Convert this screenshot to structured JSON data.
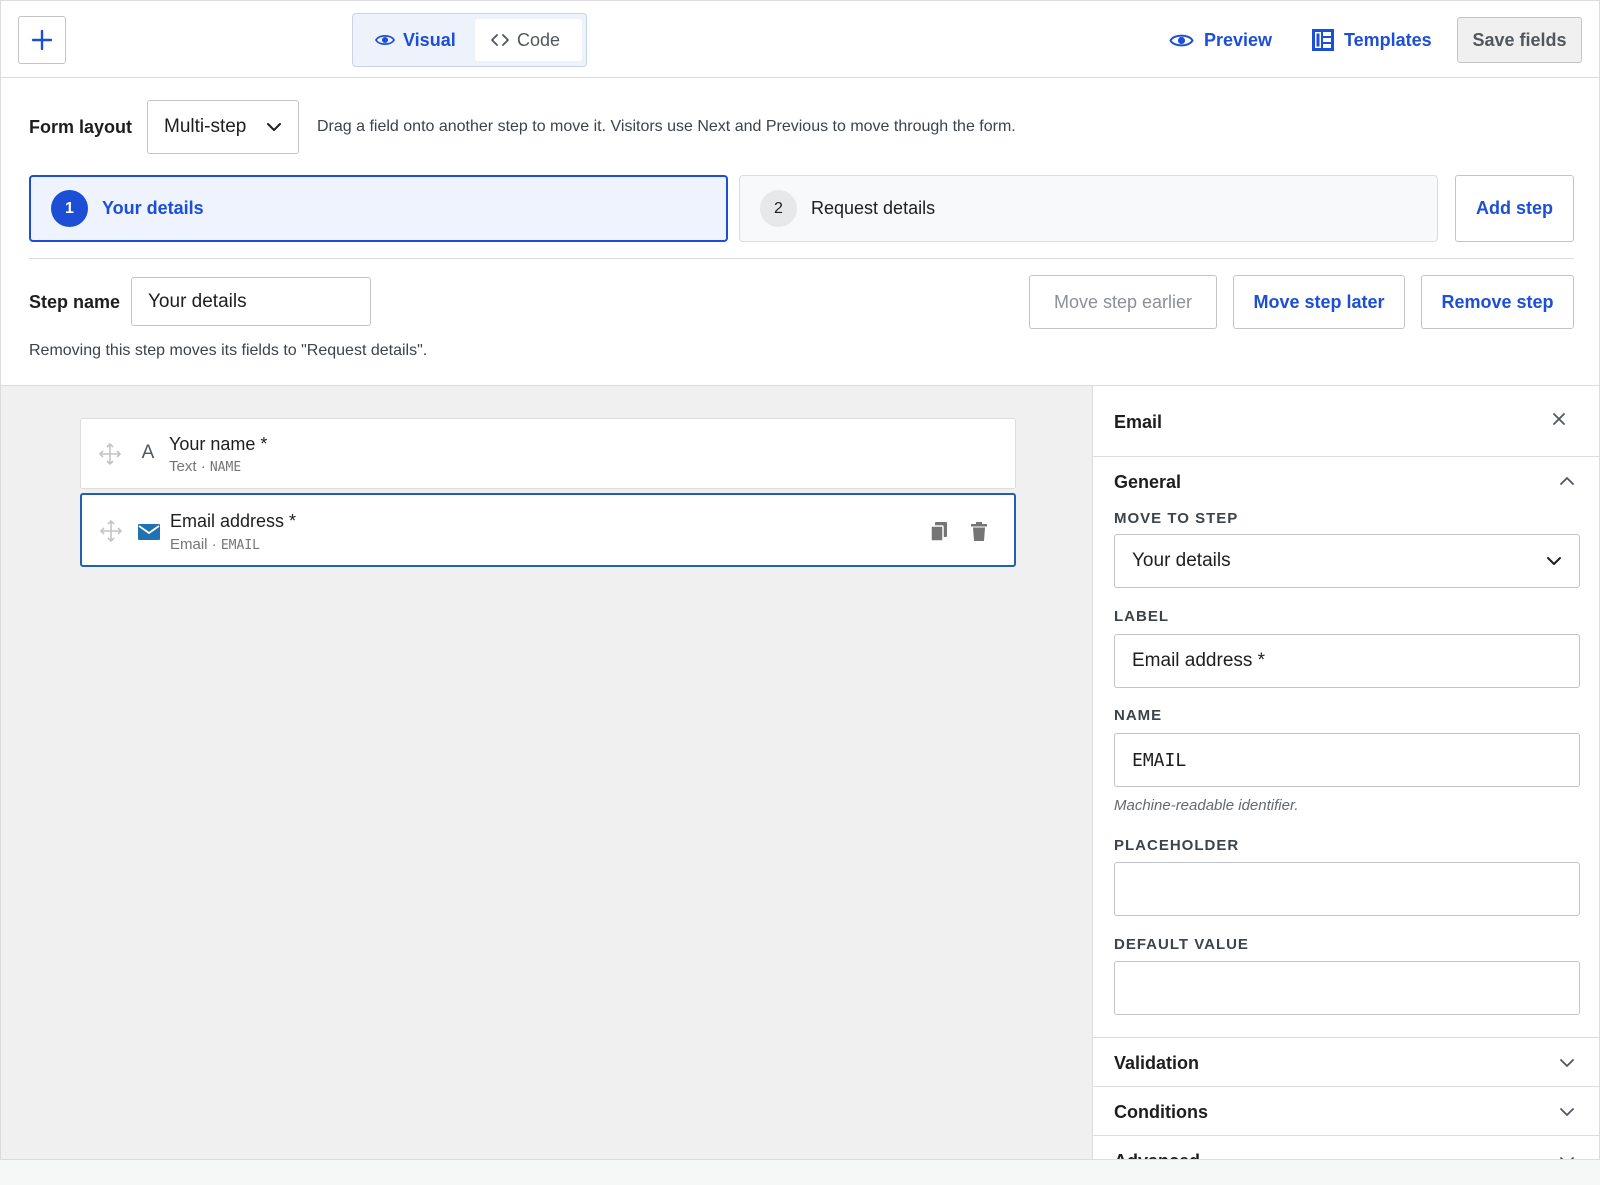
{
  "toolbar": {
    "add_icon": "plus-icon",
    "mode_visual": "Visual",
    "mode_code": "Code",
    "preview": "Preview",
    "templates": "Templates",
    "save": "Save fields",
    "accent": "#1d4fd6"
  },
  "layout": {
    "label": "Form layout",
    "selected": "Multi-step",
    "help": "Drag a field onto another step to move it. Visitors use Next and Previous to move through the form."
  },
  "steps": [
    {
      "number": "1",
      "name": "Your details",
      "active": true
    },
    {
      "number": "2",
      "name": "Request details",
      "active": false
    }
  ],
  "add_step": "Add step",
  "step_editor": {
    "label": "Step name",
    "value": "Your details",
    "move_earlier": "Move step earlier",
    "move_later": "Move step later",
    "remove": "Remove step",
    "note": "Removing this step moves its fields to \"Request details\"."
  },
  "fields": [
    {
      "label": "Your name *",
      "type": "Text",
      "name": "NAME",
      "icon": "text-A-icon"
    },
    {
      "label": "Email address *",
      "type": "Email",
      "name": "EMAIL",
      "icon": "envelope-icon",
      "selected": true
    }
  ],
  "panel": {
    "title": "Email",
    "general": "General",
    "move_to_step_label": "MOVE TO STEP",
    "move_to_step_value": "Your details",
    "label_label": "LABEL",
    "label_value": "Email address *",
    "name_label": "NAME",
    "name_value": "EMAIL",
    "name_hint": "Machine-readable identifier.",
    "placeholder_label": "PLACEHOLDER",
    "placeholder_value": "",
    "default_label": "DEFAULT VALUE",
    "default_value": "",
    "validation": "Validation",
    "conditions": "Conditions",
    "advanced": "Advanced"
  }
}
